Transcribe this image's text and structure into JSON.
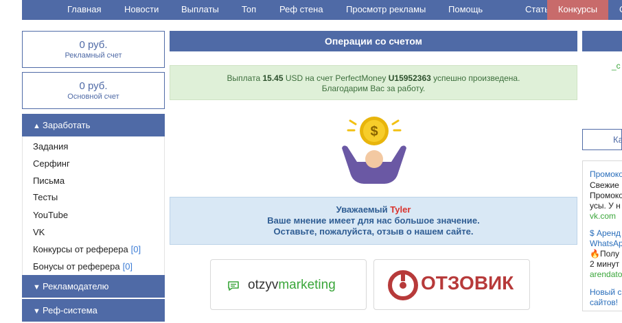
{
  "topnav": {
    "items": [
      "Главная",
      "Новости",
      "Выплаты",
      "Топ",
      "Реф стена",
      "Просмотр рекламы",
      "Помощь",
      "Статьи",
      "Конкурсы",
      "С"
    ]
  },
  "accounts": [
    {
      "amount": "0 руб.",
      "label": "Рекламный счет"
    },
    {
      "amount": "0 руб.",
      "label": "Основной счет"
    }
  ],
  "sidebar": {
    "earn_title": "Заработать",
    "earn_items": [
      {
        "label": "Задания",
        "count": ""
      },
      {
        "label": "Серфинг",
        "count": ""
      },
      {
        "label": "Письма",
        "count": ""
      },
      {
        "label": "Тесты",
        "count": ""
      },
      {
        "label": "YouTube",
        "count": ""
      },
      {
        "label": "VK",
        "count": ""
      },
      {
        "label": "Конкурсы от реферера",
        "count": "[0]"
      },
      {
        "label": "Бонусы от реферера",
        "count": "[0]"
      }
    ],
    "advertiser_title": "Рекламодателю",
    "ref_title": "Реф-система"
  },
  "main": {
    "title": "Операции со счетом",
    "success": {
      "p1": "Выплата ",
      "amount": "15.45",
      "p2": " USD на счет PerfectMoney ",
      "account": "U15952363",
      "p3": " успешно произведена.",
      "line2": "Благодарим Вас за работу."
    },
    "info": {
      "greeting": "Уважаемый ",
      "name": "Tyler",
      "line2": "Ваше мнение имеет для нас большое значение.",
      "line3": "Оставьте, пожалуйста, отзыв о нашем сайте."
    },
    "review_sites": {
      "otzyv_part1": "otzyv",
      "otzyv_part2": "marketing",
      "otzovik": "ОТЗОВИК"
    }
  },
  "right": {
    "link_fragment": "_с",
    "button_fragment": "Ка",
    "ads": [
      {
        "text": "Промоко",
        "style": "blue"
      },
      {
        "text": "Свежие",
        "style": "dark"
      },
      {
        "text": "Промоко",
        "style": "dark"
      },
      {
        "text": "усы. У н",
        "style": "dark"
      },
      {
        "text": "vk.com",
        "style": "green"
      },
      {
        "text": "$ Аренд",
        "style": "blue"
      },
      {
        "text": "WhatsAp",
        "style": "blue"
      },
      {
        "text": "🔥Полу",
        "style": "dark"
      },
      {
        "text": "2 минут",
        "style": "dark"
      },
      {
        "text": "arendato",
        "style": "green"
      },
      {
        "text": "Новый с",
        "style": "blue"
      },
      {
        "text": "сайтов!",
        "style": "blue"
      }
    ]
  },
  "colors": {
    "nav": "#4f6aa6",
    "active_tab": "#c86b6b",
    "success_bg": "#dff0d8",
    "info_bg": "#d9e8f5",
    "accent_red": "#d9332d"
  }
}
